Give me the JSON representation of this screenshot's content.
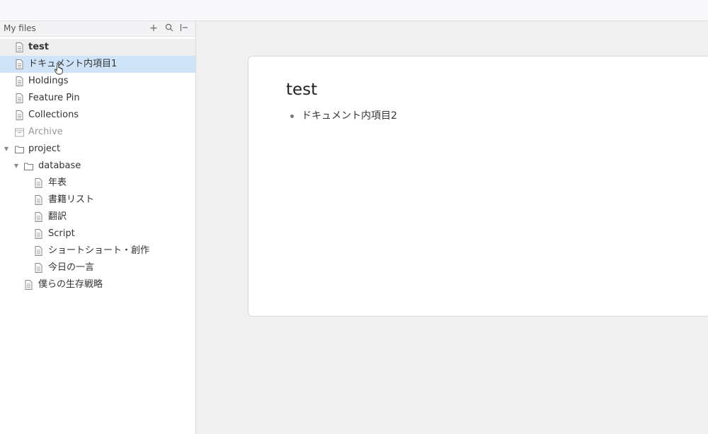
{
  "sidebar": {
    "title": "My files",
    "buttons": {
      "add": "+",
      "search_icon": "search-icon",
      "collapse": "|←"
    },
    "items": [
      {
        "label": "test",
        "icon": "document-icon"
      },
      {
        "label": "ドキュメント内項目1",
        "icon": "document-icon"
      },
      {
        "label": "Holdings",
        "icon": "document-icon"
      },
      {
        "label": "Feature Pin",
        "icon": "document-icon"
      },
      {
        "label": "Collections",
        "icon": "document-icon"
      },
      {
        "label": "Archive",
        "icon": "archive-icon"
      },
      {
        "label": "project",
        "icon": "folder-icon",
        "expanded": true
      },
      {
        "label": "database",
        "icon": "folder-icon",
        "expanded": true
      },
      {
        "label": "年表",
        "icon": "document-icon"
      },
      {
        "label": "書籍リスト",
        "icon": "document-icon"
      },
      {
        "label": "翻訳",
        "icon": "document-icon"
      },
      {
        "label": "Script",
        "icon": "document-icon"
      },
      {
        "label": "ショートショート・創作",
        "icon": "document-icon"
      },
      {
        "label": "今日の一言",
        "icon": "document-icon"
      },
      {
        "label": "僕らの生存戦略",
        "icon": "document-icon"
      }
    ]
  },
  "document": {
    "title": "test",
    "bullets": [
      "ドキュメント内項目2"
    ]
  },
  "colors": {
    "selected_row": "#cfe4f9",
    "active_row": "#eeeeef",
    "background": "#f0f0f1"
  }
}
